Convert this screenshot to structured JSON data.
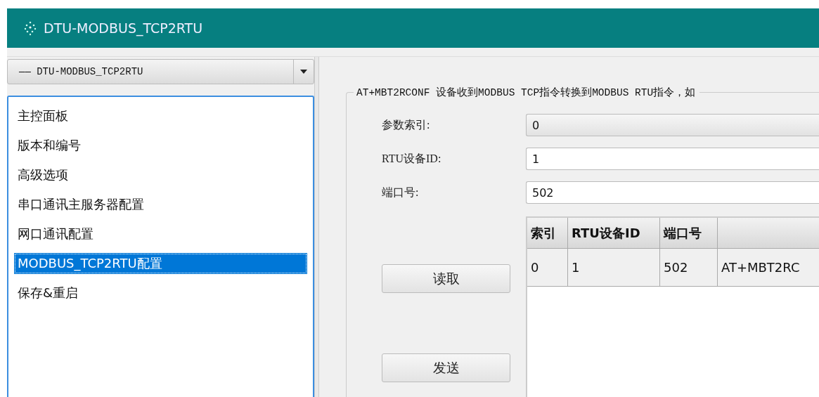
{
  "window": {
    "title": "DTU-MODBUS_TCP2RTU"
  },
  "device_select": {
    "value": "—— DTU-MODBUS_TCP2RTU"
  },
  "sidebar": {
    "items": [
      {
        "label": "主控面板",
        "selected": false
      },
      {
        "label": "版本和编号",
        "selected": false
      },
      {
        "label": "高级选项",
        "selected": false
      },
      {
        "label": "串口通讯主服务器配置",
        "selected": false
      },
      {
        "label": "网口通讯配置",
        "selected": false
      },
      {
        "label": "MODBUS_TCP2RTU配置",
        "selected": true
      },
      {
        "label": "保存&重启",
        "selected": false
      }
    ]
  },
  "group": {
    "title": "AT+MBT2RCONF 设备收到MODBUS TCP指令转换到MODBUS RTU指令，如",
    "fields": [
      {
        "label": "参数索引:",
        "value": "0",
        "kind": "combo"
      },
      {
        "label": "RTU设备ID:",
        "value": "1",
        "kind": "text"
      },
      {
        "label": "端口号:",
        "value": "502",
        "kind": "text"
      }
    ],
    "buttons": [
      "读取",
      "发送"
    ],
    "table": {
      "columns": [
        "索引",
        "RTU设备ID",
        "端口号"
      ],
      "rows": [
        [
          "0",
          "1",
          "502",
          "AT+MBT2RC"
        ]
      ]
    }
  }
}
